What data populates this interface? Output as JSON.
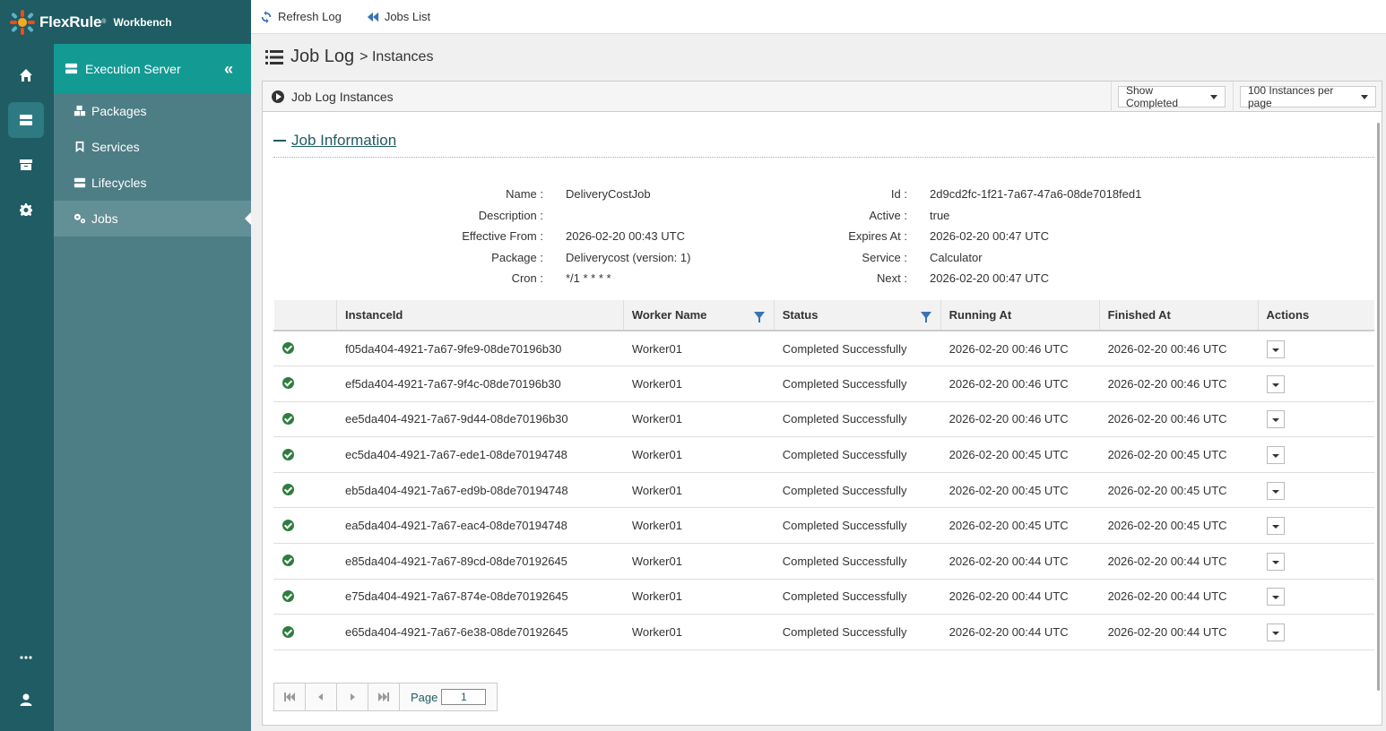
{
  "app": {
    "brand": "FlexRule",
    "brand_sup": "®",
    "product": "Workbench"
  },
  "rail": {
    "icons": [
      "home-icon",
      "server-icon",
      "archive-icon",
      "gear-icon",
      "more-icon",
      "user-icon"
    ]
  },
  "sidebar": {
    "title": "Execution Server",
    "items": [
      {
        "label": "Packages",
        "icon": "packages-icon"
      },
      {
        "label": "Services",
        "icon": "bookmark-icon"
      },
      {
        "label": "Lifecycles",
        "icon": "lifecycles-icon"
      },
      {
        "label": "Jobs",
        "icon": "gears-icon"
      }
    ]
  },
  "toolbar": {
    "refresh_label": "Refresh Log",
    "jobs_list_label": "Jobs List"
  },
  "page": {
    "title": "Job Log",
    "subtitle": "> Instances"
  },
  "panel": {
    "title": "Job Log Instances",
    "show_completed": "Show Completed",
    "per_page": "100 Instances per page"
  },
  "job_info": {
    "heading": "Job Information",
    "left": [
      {
        "label": "Name :",
        "value": "DeliveryCostJob"
      },
      {
        "label": "Description :",
        "value": ""
      },
      {
        "label": "Effective From :",
        "value": "2026-02-20 00:43 UTC"
      },
      {
        "label": "Package :",
        "value": "Deliverycost (version: 1)"
      },
      {
        "label": "Cron :",
        "value": "*/1 * * * *"
      }
    ],
    "right": [
      {
        "label": "Id :",
        "value": "2d9cd2fc-1f21-7a67-47a6-08de7018fed1"
      },
      {
        "label": "Active :",
        "value": "true"
      },
      {
        "label": "Expires At :",
        "value": "2026-02-20 00:47 UTC"
      },
      {
        "label": "Service :",
        "value": "Calculator"
      },
      {
        "label": "Next :",
        "value": "2026-02-20 00:47 UTC"
      }
    ]
  },
  "table": {
    "columns": [
      "InstanceId",
      "Worker Name",
      "Status",
      "Running At",
      "Finished At",
      "Actions"
    ],
    "rows": [
      [
        "f05da404-4921-7a67-9fe9-08de70196b30",
        "Worker01",
        "Completed Successfully",
        "2026-02-20 00:46 UTC",
        "2026-02-20 00:46 UTC"
      ],
      [
        "ef5da404-4921-7a67-9f4c-08de70196b30",
        "Worker01",
        "Completed Successfully",
        "2026-02-20 00:46 UTC",
        "2026-02-20 00:46 UTC"
      ],
      [
        "ee5da404-4921-7a67-9d44-08de70196b30",
        "Worker01",
        "Completed Successfully",
        "2026-02-20 00:46 UTC",
        "2026-02-20 00:46 UTC"
      ],
      [
        "ec5da404-4921-7a67-ede1-08de70194748",
        "Worker01",
        "Completed Successfully",
        "2026-02-20 00:45 UTC",
        "2026-02-20 00:45 UTC"
      ],
      [
        "eb5da404-4921-7a67-ed9b-08de70194748",
        "Worker01",
        "Completed Successfully",
        "2026-02-20 00:45 UTC",
        "2026-02-20 00:45 UTC"
      ],
      [
        "ea5da404-4921-7a67-eac4-08de70194748",
        "Worker01",
        "Completed Successfully",
        "2026-02-20 00:45 UTC",
        "2026-02-20 00:45 UTC"
      ],
      [
        "e85da404-4921-7a67-89cd-08de70192645",
        "Worker01",
        "Completed Successfully",
        "2026-02-20 00:44 UTC",
        "2026-02-20 00:44 UTC"
      ],
      [
        "e75da404-4921-7a67-874e-08de70192645",
        "Worker01",
        "Completed Successfully",
        "2026-02-20 00:44 UTC",
        "2026-02-20 00:44 UTC"
      ],
      [
        "e65da404-4921-7a67-6e38-08de70192645",
        "Worker01",
        "Completed Successfully",
        "2026-02-20 00:44 UTC",
        "2026-02-20 00:44 UTC"
      ]
    ]
  },
  "pager": {
    "label": "Page",
    "value": "1"
  },
  "colors": {
    "rail": "#1f5c63",
    "sidebar": "#4d7d85",
    "sidebar_head": "#139a93",
    "link": "#3a73b5",
    "success": "#2e7d3e"
  }
}
